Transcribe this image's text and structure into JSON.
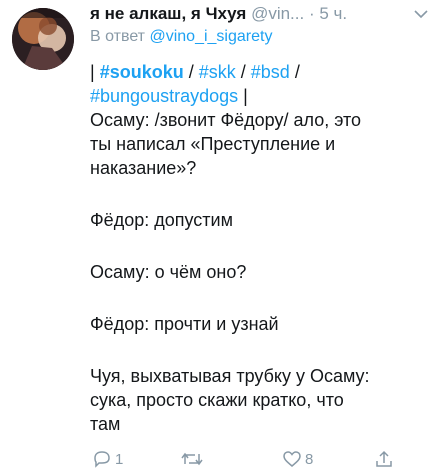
{
  "tweet": {
    "display_name": "я не алкаш, я Чхуя",
    "handle": "@vin...",
    "dot": "·",
    "time": "5 ч.",
    "reply_prefix": "В ответ",
    "reply_to": "@vino_i_sigarety",
    "tags_line1": {
      "bar_open": "| ",
      "tag1": "#soukoku",
      "sep1": " / ",
      "tag2": "#skk",
      "sep2": " / ",
      "tag3": "#bsd",
      "sep3": " /"
    },
    "tags_line2": {
      "tag4": "#bungoustraydogs",
      "bar_close": " |"
    },
    "lines": [
      "Осаму: /звонит Фёдору/ ало, это",
      "ты написал «Преступление и",
      "наказание»?",
      "Фёдор: допустим",
      "Осаму: о чём оно?",
      "Фёдор: прочти и узнай",
      "Чуя, выхватывая трубку у Осаму:",
      "сука, просто скажи кратко, что",
      "там"
    ],
    "actions": {
      "reply_icon": "reply-icon",
      "reply_count": "1",
      "retweet_icon": "retweet-icon",
      "like_icon": "heart-icon",
      "like_count": "8",
      "share_icon": "share-icon"
    }
  },
  "colors": {
    "text": "#14171a",
    "muted": "#8899a6",
    "link": "#1da1f2",
    "background": "#ffffff"
  }
}
